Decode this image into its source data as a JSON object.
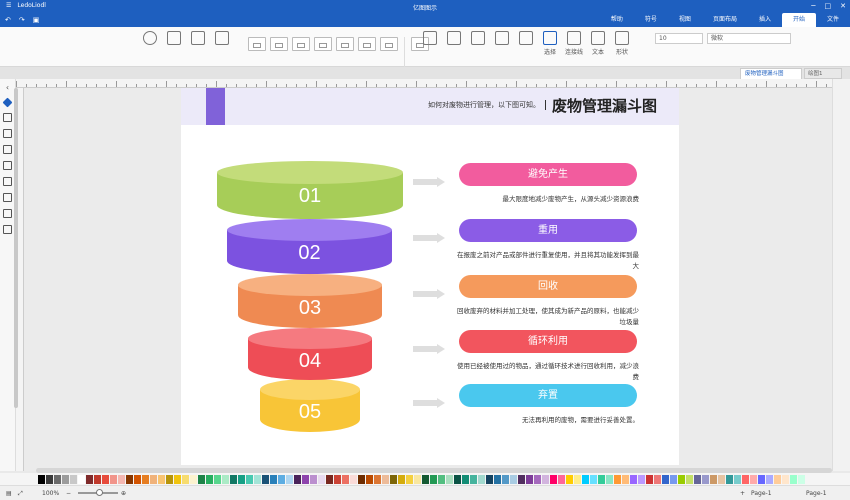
{
  "window": {
    "title": "亿图图示",
    "controls": [
      "─",
      "□",
      "✕"
    ],
    "left_icons": [
      "搜索",
      "LedoLiodl"
    ]
  },
  "menu": {
    "tabs": [
      {
        "label": "文件",
        "active": false
      },
      {
        "label": "开始",
        "active": true
      },
      {
        "label": "插入",
        "active": false
      },
      {
        "label": "页面布局",
        "active": false
      },
      {
        "label": "视图",
        "active": false
      },
      {
        "label": "符号",
        "active": false
      },
      {
        "label": "帮助",
        "active": false
      }
    ]
  },
  "ribbon": {
    "tools": [
      {
        "label": "选择"
      },
      {
        "label": "连接线"
      },
      {
        "label": "文本"
      },
      {
        "label": "形状"
      }
    ],
    "font_name": "微软",
    "font_size": "10"
  },
  "tabs": {
    "document": "废物管理漏斗图",
    "second": "绘图1"
  },
  "page": {
    "title": "废物管理漏斗图",
    "subtitle": "如何对废物进行管理，以下图可知。",
    "header_bar_color": "#8062d9",
    "header_bg": "#eceaf9"
  },
  "funnel": [
    {
      "num": "01",
      "label": "避免产生",
      "desc": "最大限度地减少废物产生，从源头减少资源浪费",
      "color": "#f25c9e",
      "disk_top": "#c3dc7a",
      "disk_body": "#a7cd58"
    },
    {
      "num": "02",
      "label": "重用",
      "desc": "在报废之前对产品或部件进行重复使用，并且将其功能发挥到最大",
      "color": "#8b5ce6",
      "disk_top": "#9f7ef0",
      "disk_body": "#7c52e0"
    },
    {
      "num": "03",
      "label": "回收",
      "desc": "回收废弃的材料并加工处理，使其成为新产品的原料，也能减少垃圾量",
      "color": "#f59a5c",
      "disk_top": "#f7b080",
      "disk_body": "#ef8a52"
    },
    {
      "num": "04",
      "label": "循环利用",
      "desc": "使用已经被使用过的物品，通过循环技术进行回收利用，减少浪费",
      "color": "#f2555e",
      "disk_top": "#f57a80",
      "disk_body": "#ee4d56"
    },
    {
      "num": "05",
      "label": "弃置",
      "desc": "无法再利用的废物，需要进行妥善处置。",
      "color": "#4ac8ee",
      "disk_top": "#fbd567",
      "disk_body": "#f8c537"
    }
  ],
  "status": {
    "page_label": "Page-1",
    "page_label2": "Page-1",
    "zoom": "100%"
  },
  "palette": [
    "#000000",
    "#3b3b3b",
    "#6b6b6b",
    "#9c9c9c",
    "#c8c8c8",
    "#ffffff",
    "#7f2b2b",
    "#c0392b",
    "#e74c3c",
    "#f1948a",
    "#f5b7b1",
    "#873600",
    "#d35400",
    "#e67e22",
    "#f0b27a",
    "#f8c471",
    "#b7950b",
    "#f1c40f",
    "#f7dc6f",
    "#fcf3cf",
    "#1d8348",
    "#27ae60",
    "#58d68d",
    "#abebc6",
    "#117864",
    "#16a085",
    "#48c9b0",
    "#a3e4d7",
    "#1a5276",
    "#2980b9",
    "#5dade2",
    "#aed6f1",
    "#4a235a",
    "#8e44ad",
    "#bb8fce",
    "#e8daef",
    "#78281f",
    "#cb4335",
    "#ec7063",
    "#fadbd8",
    "#6e2c00",
    "#ba4a00",
    "#dc7633",
    "#edbb99",
    "#7d6608",
    "#d4ac0d",
    "#f4d03f",
    "#f9e79f",
    "#145a32",
    "#229954",
    "#52be80",
    "#a9dfbf",
    "#0b5345",
    "#138d75",
    "#45b39d",
    "#a2d9ce",
    "#154360",
    "#2471a3",
    "#5499c7",
    "#a9cce3",
    "#512e5f",
    "#7d3c98",
    "#a569bd",
    "#d2b4de",
    "#ff0066",
    "#ff6699",
    "#ffcc00",
    "#ffee88",
    "#00ccff",
    "#66e0ff",
    "#33cc99",
    "#88e6c4",
    "#ff9933",
    "#ffbb77",
    "#9966ff",
    "#bb99ff",
    "#cc3333",
    "#ee7777",
    "#3366cc",
    "#7799ee",
    "#99cc00",
    "#c4e066",
    "#666699",
    "#9999cc",
    "#cc9966",
    "#e6c4a3",
    "#339999",
    "#77cccc",
    "#ff6666",
    "#ffaaaa",
    "#6666ff",
    "#aaaaff",
    "#ffcc99",
    "#ffe6cc",
    "#99ffcc",
    "#ccffe6"
  ]
}
